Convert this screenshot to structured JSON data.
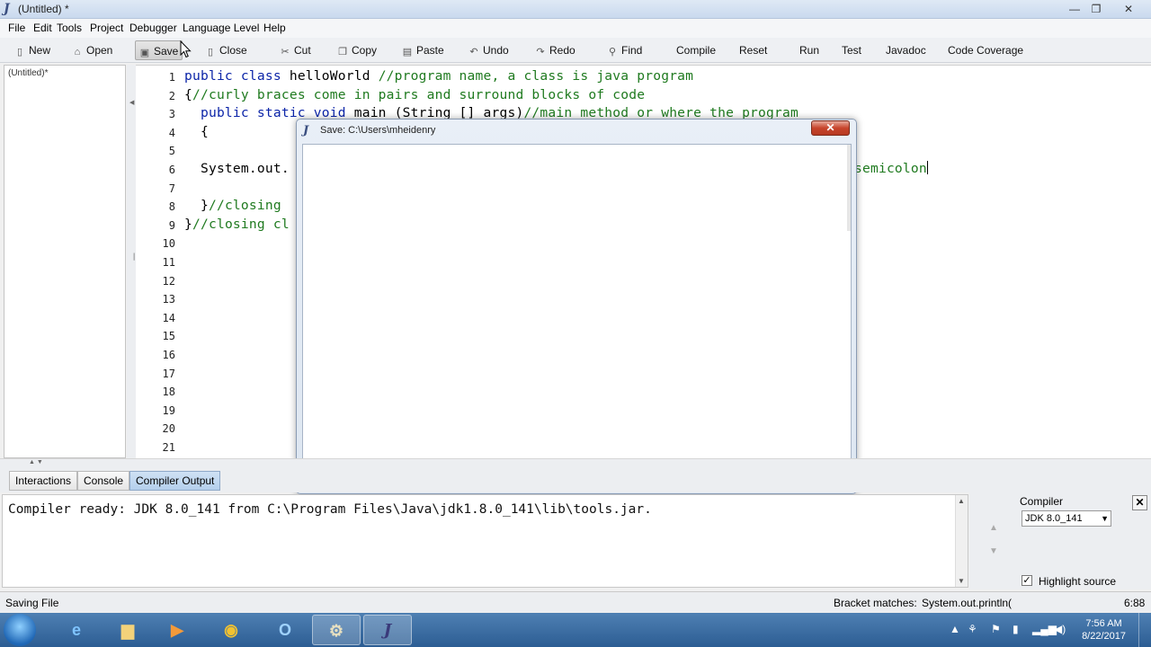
{
  "window": {
    "title": "(Untitled) *",
    "minimize": "—",
    "maximize": "❐",
    "close": "✕"
  },
  "menu": [
    "File",
    "Edit",
    "Tools",
    "Project",
    "Debugger",
    "Language Level",
    "Help"
  ],
  "toolbar": {
    "new": "New",
    "open": "Open",
    "save": "Save",
    "close": "Close",
    "cut": "Cut",
    "copy": "Copy",
    "paste": "Paste",
    "undo": "Undo",
    "redo": "Redo",
    "find": "Find",
    "compile": "Compile",
    "reset": "Reset",
    "run": "Run",
    "test": "Test",
    "javadoc": "Javadoc",
    "coverage": "Code Coverage"
  },
  "documents": [
    "(Untitled)*"
  ],
  "editor": {
    "line_numbers": [
      "1",
      "2",
      "3",
      "4",
      "5",
      "6",
      "7",
      "8",
      "9",
      "10",
      "11",
      "12",
      "13",
      "14",
      "15",
      "16",
      "17",
      "18",
      "19",
      "20",
      "21"
    ],
    "lines": {
      "l1a": "public class",
      "l1b": " helloWorld ",
      "l1c": "//program name, a class is java program",
      "l2a": "{",
      "l2b": "//curly braces come in pairs and surround blocks of code",
      "l3a": "  public static void",
      "l3b": " main (String [] args)",
      "l3c": "//main method or where the program",
      "l4": "  {",
      "l6a": "  System.out.",
      "l6b": "semicolon",
      "l8a": "  }",
      "l8b": "//closing ",
      "l9a": "}",
      "l9b": "//closing cl"
    }
  },
  "dialog": {
    "title": "Save:  C:\\Users\\mheidenry",
    "close": "✕"
  },
  "bottom_tabs": [
    "Interactions",
    "Console",
    "Compiler Output"
  ],
  "output": "Compiler ready: JDK 8.0_141 from C:\\Program Files\\Java\\jdk1.8.0_141\\lib\\tools.jar.",
  "compiler_panel": {
    "label": "Compiler",
    "selected": "JDK 8.0_141",
    "highlight_label": "Highlight source",
    "highlight_checked": true
  },
  "status": {
    "left": "Saving File",
    "bracket_label": "Bracket matches:",
    "bracket_value": "System.out.println(",
    "position": "6:88"
  },
  "taskbar": {
    "time": "7:56 AM",
    "date": "8/22/2017"
  }
}
